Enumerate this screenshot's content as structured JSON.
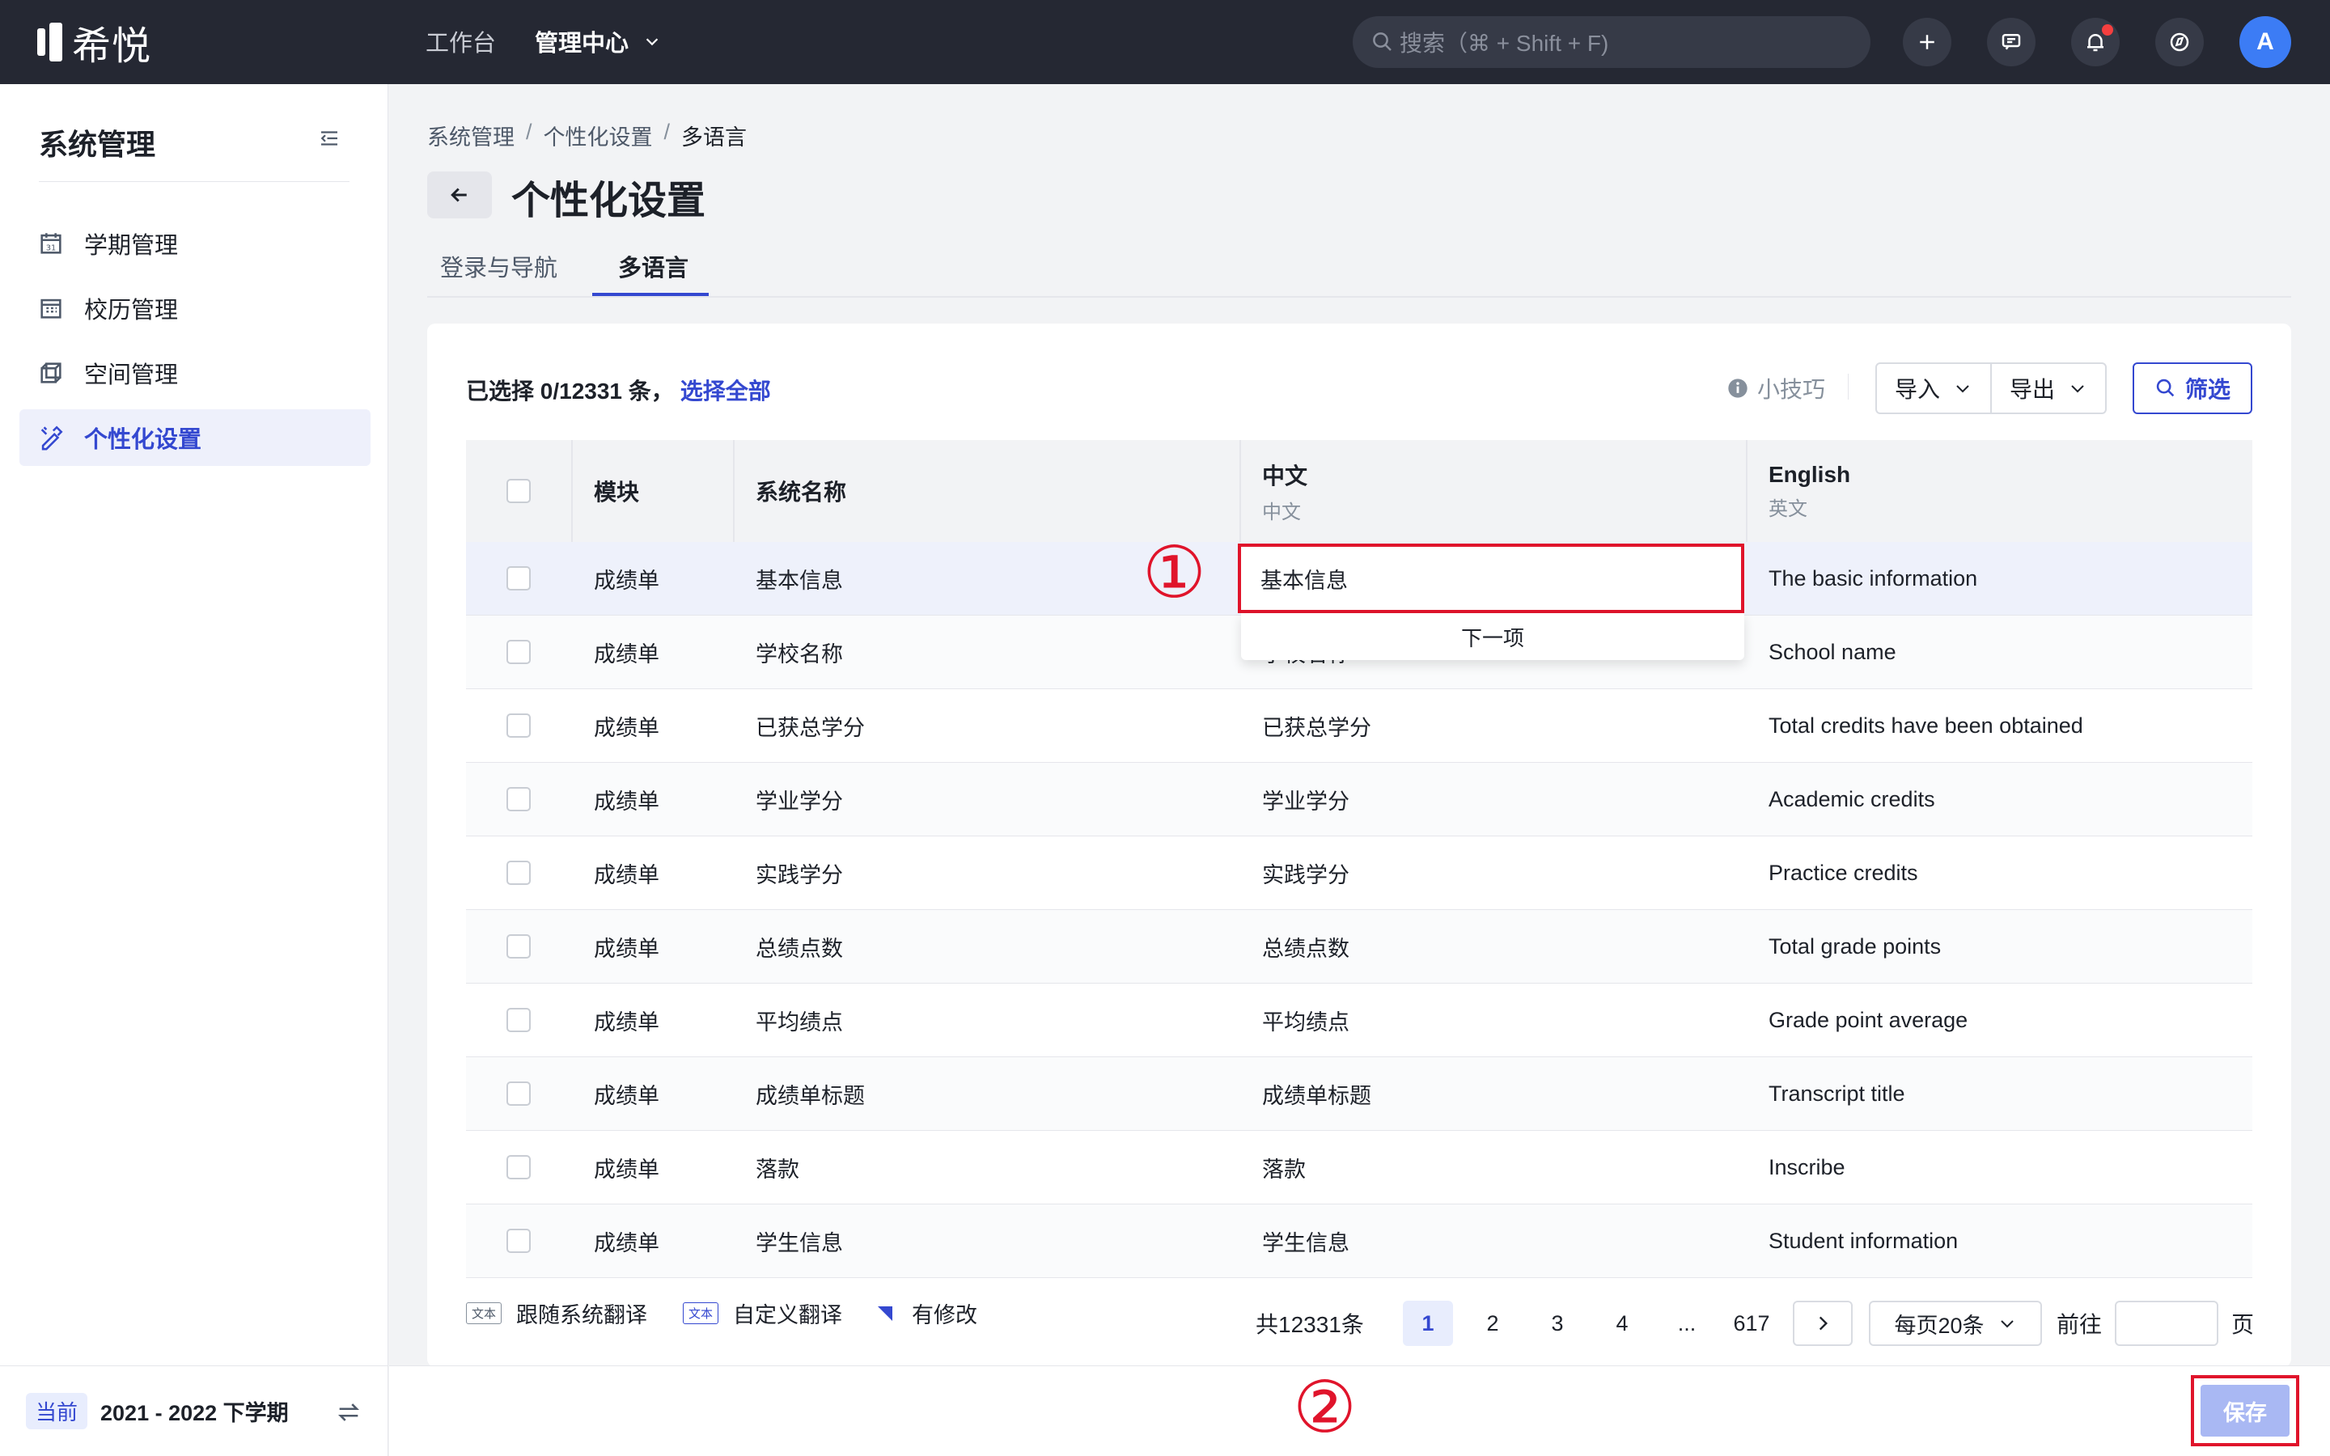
{
  "header": {
    "logo_text": "希悦",
    "nav": [
      {
        "label": "工作台"
      },
      {
        "label": "管理中心"
      }
    ],
    "search_placeholder": "搜索（⌘ + Shift + F)",
    "avatar_initial": "A"
  },
  "sidebar": {
    "title": "系统管理",
    "items": [
      {
        "label": "学期管理",
        "icon": "calendar-icon"
      },
      {
        "label": "校历管理",
        "icon": "school-calendar-icon"
      },
      {
        "label": "空间管理",
        "icon": "cube-icon"
      },
      {
        "label": "个性化设置",
        "icon": "brush-icon",
        "active": true
      }
    ],
    "term_tag": "当前",
    "term": "2021 - 2022 下学期"
  },
  "breadcrumb": [
    "系统管理",
    "个性化设置",
    "多语言"
  ],
  "page_title": "个性化设置",
  "tabs": [
    {
      "label": "登录与导航"
    },
    {
      "label": "多语言",
      "active": true
    }
  ],
  "toolbar": {
    "selected_text": "已选择 0/12331 条，",
    "select_all": "选择全部",
    "tip": "小技巧",
    "import": "导入",
    "export": "导出",
    "filter": "筛选"
  },
  "table": {
    "columns": {
      "module": "模块",
      "system_name": "系统名称",
      "chinese": "中文",
      "chinese_sub": "中文",
      "english": "English",
      "english_sub": "英文"
    },
    "rows": [
      {
        "module": "成绩单",
        "name": "基本信息",
        "zh": "基本信息",
        "en": "The basic information"
      },
      {
        "module": "成绩单",
        "name": "学校名称",
        "zh": "学校名称",
        "en": "School name"
      },
      {
        "module": "成绩单",
        "name": "已获总学分",
        "zh": "已获总学分",
        "en": "Total credits have been obtained"
      },
      {
        "module": "成绩单",
        "name": "学业学分",
        "zh": "学业学分",
        "en": "Academic credits"
      },
      {
        "module": "成绩单",
        "name": "实践学分",
        "zh": "实践学分",
        "en": "Practice credits"
      },
      {
        "module": "成绩单",
        "name": "总绩点数",
        "zh": "总绩点数",
        "en": "Total grade points"
      },
      {
        "module": "成绩单",
        "name": "平均绩点",
        "zh": "平均绩点",
        "en": "Grade point average"
      },
      {
        "module": "成绩单",
        "name": "成绩单标题",
        "zh": "成绩单标题",
        "en": "Transcript title"
      },
      {
        "module": "成绩单",
        "name": "落款",
        "zh": "落款",
        "en": "Inscribe"
      },
      {
        "module": "成绩单",
        "name": "学生信息",
        "zh": "学生信息",
        "en": "Student information"
      }
    ],
    "editing_value": "基本信息",
    "next_item": "下一项"
  },
  "annotations": {
    "one": "①",
    "two": "②"
  },
  "legend": {
    "tag": "文本",
    "follow_system": "跟随系统翻译",
    "custom": "自定义翻译",
    "modified": "有修改"
  },
  "pagination": {
    "total": "共12331条",
    "pages": [
      "1",
      "2",
      "3",
      "4",
      "...",
      "617"
    ],
    "current": "1",
    "page_size": "每页20条",
    "goto": "前往",
    "page_unit": "页"
  },
  "footer": {
    "save": "保存"
  },
  "colors": {
    "accent": "#3448d0",
    "highlight_red": "#e0142b",
    "topbar": "#252833"
  }
}
